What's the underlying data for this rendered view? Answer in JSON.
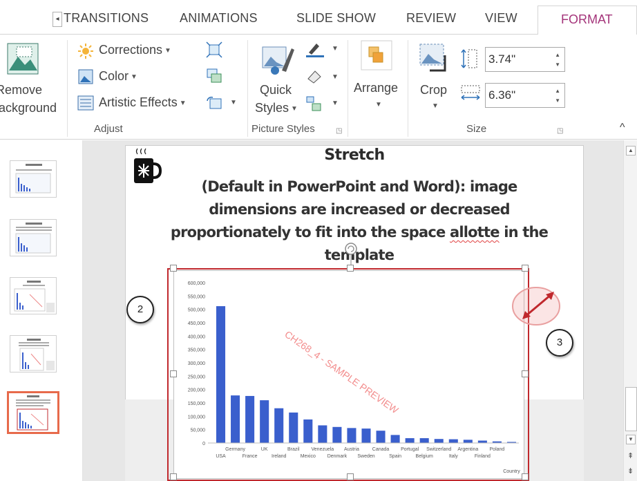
{
  "tabs": {
    "scroll_glyph": "◂",
    "transitions": "TRANSITIONS",
    "animations": "ANIMATIONS",
    "slide_show": "SLIDE SHOW",
    "review": "REVIEW",
    "view": "VIEW",
    "format": "FORMAT"
  },
  "ribbon": {
    "remove_background": {
      "line1": "Remove",
      "line2": "Background"
    },
    "corrections": "Corrections",
    "color": "Color",
    "artistic_effects": "Artistic Effects",
    "adjust_label": "Adjust",
    "quick_styles": {
      "line1": "Quick",
      "line2": "Styles"
    },
    "picture_styles_label": "Picture Styles",
    "arrange": "Arrange",
    "crop": "Crop",
    "height_value": "3.74\"",
    "width_value": "6.36\"",
    "size_label": "Size",
    "collapse_glyph": "^"
  },
  "slide": {
    "title": "Stretch",
    "body_part1": "(Default in PowerPoint and Word): image dimensions are increased or decreased proportionately to fit into the space ",
    "body_misspelled": "allotte",
    "body_part2": " in the template"
  },
  "callouts": {
    "left": "2",
    "right": "3"
  },
  "chart_data": {
    "type": "bar",
    "categories": [
      "USA",
      "Germany",
      "France",
      "UK",
      "Ireland",
      "Brazil",
      "Mexico",
      "Venezuela",
      "Denmark",
      "Austria",
      "Sweden",
      "Canada",
      "Spain",
      "Portugal",
      "Belgium",
      "Switzerland",
      "Italy",
      "Argentina",
      "Finland",
      "Poland",
      "Country"
    ],
    "values": [
      512000,
      178000,
      176000,
      160000,
      130000,
      114000,
      88000,
      66000,
      60000,
      56000,
      54000,
      46000,
      30000,
      18000,
      18000,
      15000,
      14000,
      12000,
      9000,
      6000,
      4000
    ],
    "y_ticks": [
      "0",
      "50,000",
      "100,000",
      "150,000",
      "200,000",
      "250,000",
      "300,000",
      "350,000",
      "400,000",
      "450,000",
      "500,000",
      "550,000",
      "600,000"
    ],
    "ylim": [
      0,
      600000
    ],
    "watermark": "CH268_4 - SAMPLE PREVIEW",
    "bar_color": "#3a5fcd"
  },
  "colors": {
    "accent": "#a4347a",
    "selection": "#c0282d",
    "thumb_selected": "#e76a4b"
  }
}
